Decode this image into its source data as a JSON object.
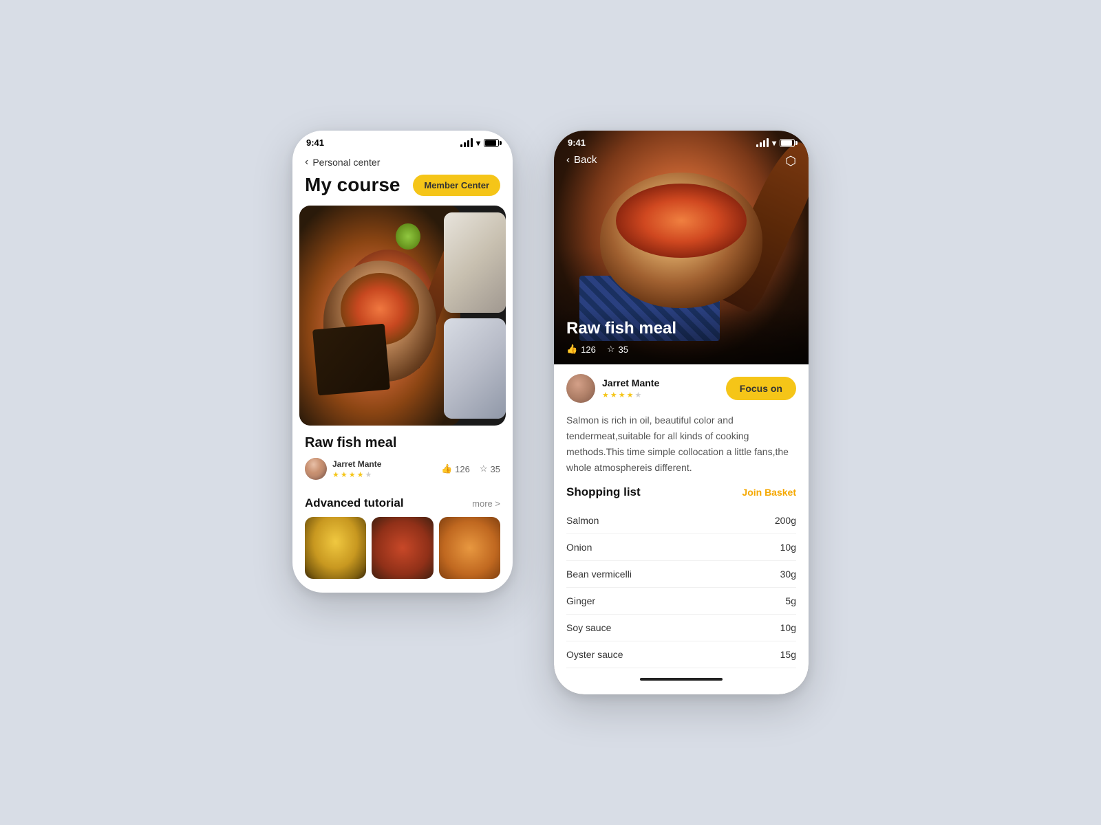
{
  "left_phone": {
    "status_bar": {
      "time": "9:41"
    },
    "nav": {
      "back_label": "Personal center"
    },
    "header": {
      "title": "My course",
      "member_btn": "Member Center"
    },
    "course": {
      "title": "Raw fish meal",
      "chef_name": "Jarret Mante",
      "stars": 4,
      "likes": "126",
      "favorites": "35"
    },
    "advanced": {
      "section_title": "Advanced tutorial",
      "more_label": "more >"
    }
  },
  "right_phone": {
    "status_bar": {
      "time": "9:41"
    },
    "nav": {
      "back_label": "Back"
    },
    "hero": {
      "title": "Raw fish meal",
      "likes": "126",
      "favorites": "35"
    },
    "author": {
      "name": "Jarret Mante",
      "stars": 4,
      "focus_btn": "Focus on"
    },
    "description": "Salmon is rich in oil, beautiful color and tendermeat,suitable for all kinds of cooking methods.This time simple collocation a little fans,the whole atmosphereis different.",
    "shopping": {
      "title": "Shopping list",
      "join_basket": "Join Basket",
      "items": [
        {
          "name": "Salmon",
          "qty": "200g"
        },
        {
          "name": "Onion",
          "qty": "10g"
        },
        {
          "name": "Bean vermicelli",
          "qty": "30g"
        },
        {
          "name": "Ginger",
          "qty": "5g"
        },
        {
          "name": "Soy sauce",
          "qty": "10g"
        },
        {
          "name": "Oyster sauce",
          "qty": "15g"
        }
      ]
    }
  }
}
